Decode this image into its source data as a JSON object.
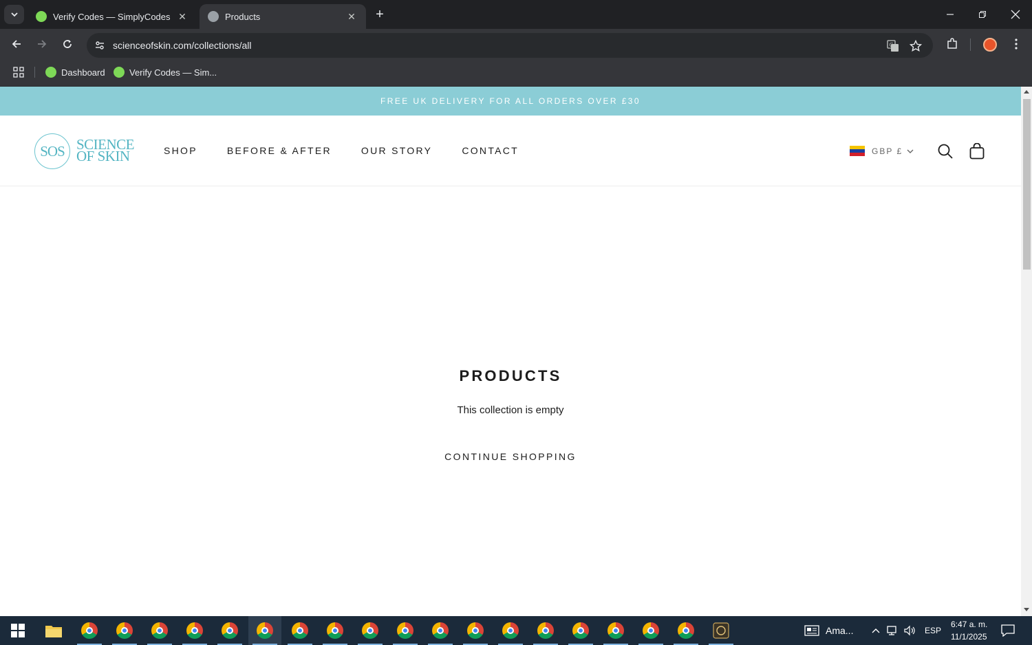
{
  "browser": {
    "tabs": [
      {
        "title": "Verify Codes — SimplyCodes",
        "active": false
      },
      {
        "title": "Products",
        "active": true
      }
    ],
    "url": "scienceofskin.com/collections/all",
    "bookmarks": [
      {
        "label": "Dashboard"
      },
      {
        "label": "Verify Codes — Sim..."
      }
    ]
  },
  "site": {
    "announcement": "FREE UK DELIVERY FOR ALL ORDERS OVER £30",
    "logo_mark": "SOS",
    "logo_line1": "SCIENCE",
    "logo_line2": "OF SKIN",
    "nav": [
      "SHOP",
      "BEFORE & AFTER",
      "OUR STORY",
      "CONTACT"
    ],
    "currency": "GBP £",
    "page_title": "PRODUCTS",
    "empty_message": "This collection is empty",
    "continue_label": "CONTINUE SHOPPING"
  },
  "taskbar": {
    "pinned_label": "Ama...",
    "language": "ESP",
    "time": "6:47 a. m.",
    "date": "11/1/2025"
  },
  "colors": {
    "announcement_bg": "#8bcdd6",
    "brand_teal": "#54b5c3",
    "chrome_dark": "#202124",
    "taskbar": "#1b2a3a"
  }
}
